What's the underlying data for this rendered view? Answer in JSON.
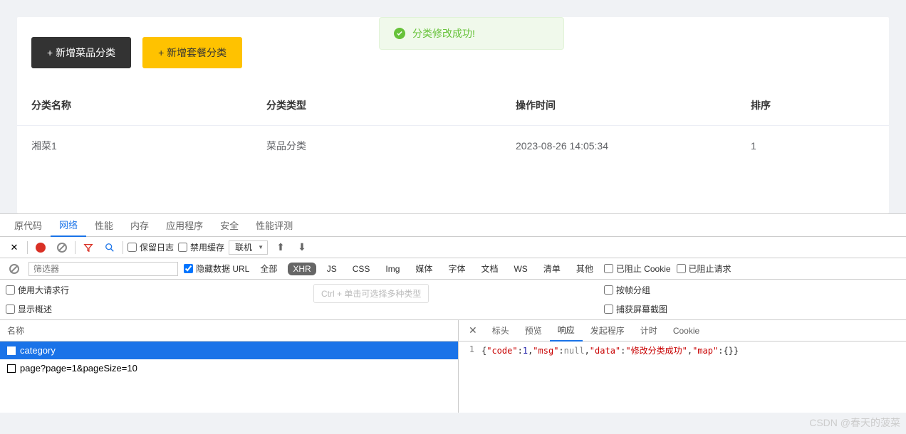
{
  "toast": {
    "message": "分类修改成功!"
  },
  "buttons": {
    "add_dish": "+ 新增菜品分类",
    "add_combo": "+ 新增套餐分类"
  },
  "table": {
    "headers": [
      "分类名称",
      "分类类型",
      "操作时间",
      "排序"
    ],
    "rows": [
      {
        "name": "湘菜1",
        "type": "菜品分类",
        "time": "2023-08-26 14:05:34",
        "sort": "1"
      }
    ]
  },
  "devtools": {
    "main_tabs": [
      "原代码",
      "网络",
      "性能",
      "内存",
      "应用程序",
      "安全",
      "性能评测"
    ],
    "active_main_tab": 1,
    "toolbar": {
      "preserve_log": "保留日志",
      "disable_cache": "禁用缓存",
      "throttle": "联机"
    },
    "filter": {
      "placeholder": "筛选器",
      "hide_data_urls": "隐藏数据 URL",
      "types": [
        "全部",
        "XHR",
        "JS",
        "CSS",
        "Img",
        "媒体",
        "字体",
        "文档",
        "WS",
        "清单",
        "其他"
      ],
      "blocked_cookies": "已阻止 Cookie",
      "blocked_requests": "已阻止请求"
    },
    "options": {
      "large_rows": "使用大请求行",
      "show_overview": "显示概述",
      "group_by_frame": "按帧分组",
      "capture_screenshots": "捕获屏幕截图",
      "hint": "Ctrl + 单击可选择多种类型"
    },
    "requests": {
      "header": "名称",
      "items": [
        "category",
        "page?page=1&pageSize=10"
      ],
      "selected": 0
    },
    "response": {
      "tabs": [
        "标头",
        "预览",
        "响应",
        "发起程序",
        "计时",
        "Cookie"
      ],
      "active": 2,
      "line": "1",
      "json": {
        "code": 1,
        "msg_key": "msg",
        "msg_val": "null",
        "data_key": "data",
        "data_val": "修改分类成功",
        "map_key": "map"
      }
    }
  },
  "watermark": "CSDN @春天的菠菜"
}
